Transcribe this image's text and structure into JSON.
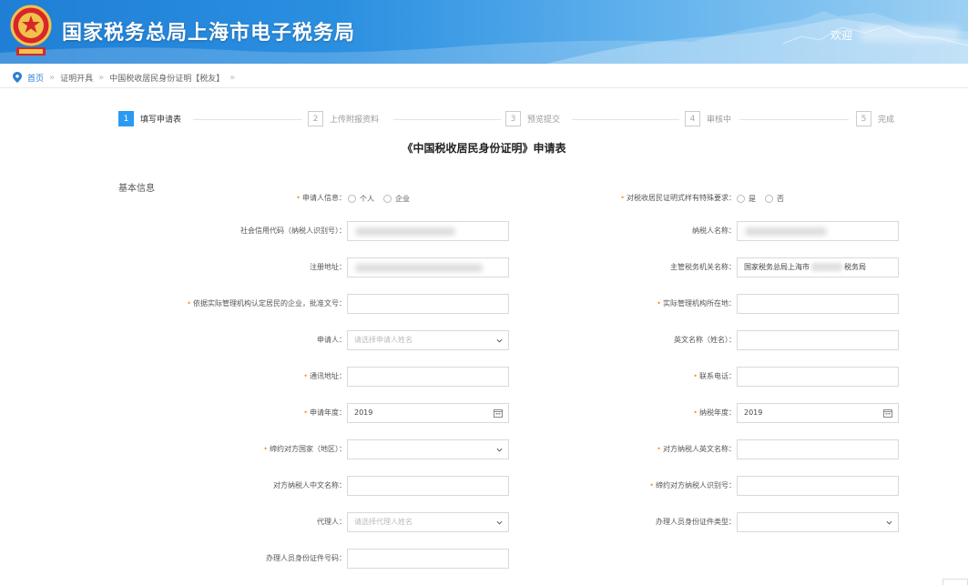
{
  "header": {
    "site_title": "国家税务总局上海市电子税务局",
    "welcome": "欢迎"
  },
  "breadcrumb": {
    "items": [
      "首页",
      "证明开具",
      "中国税收居民身份证明【税友】"
    ]
  },
  "steps": [
    {
      "num": "1",
      "label": "填写申请表"
    },
    {
      "num": "2",
      "label": "上传附报资料"
    },
    {
      "num": "3",
      "label": "预览提交"
    },
    {
      "num": "4",
      "label": "审核中"
    },
    {
      "num": "5",
      "label": "完成"
    }
  ],
  "form": {
    "title": "《中国税收居民身份证明》申请表",
    "section": "基本信息",
    "applicant_info_label": "申请人信息：",
    "applicant_options": [
      "个人",
      "企业"
    ],
    "special_req_label": "对税收居民证明式样有特殊要求：",
    "special_req_options": [
      "是",
      "否"
    ],
    "credit_code_label": "社会信用代码（纳税人识别号）：",
    "taxpayer_name_label": "纳税人名称：",
    "reg_address_label": "注册地址：",
    "tax_authority_label": "主管税务机关名称：",
    "tax_authority_value_a": "国家税务总局上海市",
    "tax_authority_value_b": "税务局",
    "approval_doc_label": "依据实际管理机构认定居民的企业，批准文号：",
    "mgmt_location_label": "实际管理机构所在地：",
    "applicant_label": "申请人：",
    "applicant_placeholder": "请选择申请人姓名",
    "english_name_label": "英文名称（姓名）：",
    "mail_address_label": "通讯地址：",
    "phone_label": "联系电话：",
    "apply_year_label": "申请年度：",
    "apply_year_value": "2019",
    "tax_year_label": "纳税年度：",
    "tax_year_value": "2019",
    "treaty_country_label": "缔约对方国家（地区）：",
    "other_en_name_label": "对方纳税人英文名称：",
    "other_cn_name_label": "对方纳税人中文名称：",
    "other_tin_label": "缔约对方纳税人识别号：",
    "agent_label": "代理人：",
    "agent_placeholder": "请选择代理人姓名",
    "handler_id_type_label": "办理人员身份证件类型：",
    "handler_id_no_label": "办理人员身份证件号码："
  }
}
